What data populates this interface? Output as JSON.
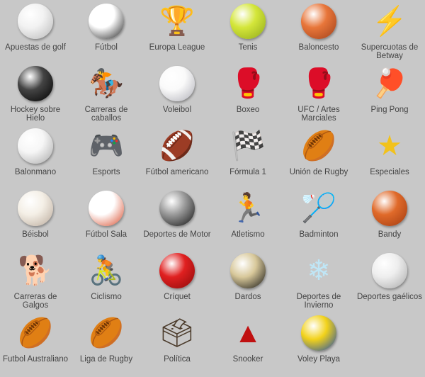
{
  "sports": [
    {
      "label": "Apuestas de golf",
      "icon": "golf-ball-icon",
      "shape": "ball",
      "color": "#f2f2f2",
      "shade": "#b8b8b8"
    },
    {
      "label": "Fútbol",
      "icon": "soccer-ball-icon",
      "shape": "ball",
      "color": "#ffffff",
      "shade": "#222222"
    },
    {
      "label": "Europa League",
      "icon": "trophy-icon",
      "shape": "glyph",
      "glyph": "🏆",
      "color": "#9a9a9a"
    },
    {
      "label": "Tenis",
      "icon": "tennis-ball-icon",
      "shape": "ball",
      "color": "#d4e63a",
      "shade": "#8fa81a"
    },
    {
      "label": "Baloncesto",
      "icon": "basketball-icon",
      "shape": "ball",
      "color": "#e8763a",
      "shade": "#a0401a"
    },
    {
      "label": "Supercuotas de\nBetway",
      "icon": "lightning-icon",
      "shape": "glyph",
      "glyph": "⚡",
      "color": "#3cb53c"
    },
    {
      "label": "Hockey sobre\nHielo",
      "icon": "hockey-puck-icon",
      "shape": "ball",
      "color": "#444444",
      "shade": "#000000"
    },
    {
      "label": "Carreras de\ncaballos",
      "icon": "horse-racing-icon",
      "shape": "glyph",
      "glyph": "🏇",
      "color": "#6b3a1f"
    },
    {
      "label": "Voleibol",
      "icon": "volleyball-icon",
      "shape": "ball",
      "color": "#fafafa",
      "shade": "#b0b0b8"
    },
    {
      "label": "Boxeo",
      "icon": "boxing-gloves-icon",
      "shape": "glyph",
      "glyph": "🥊",
      "color": "#a81c1c"
    },
    {
      "label": "UFC / Artes\nMarciales",
      "icon": "mma-gloves-icon",
      "shape": "glyph",
      "glyph": "🥊",
      "color": "#222222"
    },
    {
      "label": "Ping Pong",
      "icon": "ping-pong-icon",
      "shape": "glyph",
      "glyph": "🏓",
      "color": "#d42020"
    },
    {
      "label": "Balonmano",
      "icon": "handball-icon",
      "shape": "ball",
      "color": "#f6f6f6",
      "shade": "#a8a8a8"
    },
    {
      "label": "Esports",
      "icon": "gamepad-icon",
      "shape": "glyph",
      "glyph": "🎮",
      "color": "#333333"
    },
    {
      "label": "Fútbol americano",
      "icon": "american-football-icon",
      "shape": "glyph",
      "glyph": "🏈",
      "color": "#8b4513"
    },
    {
      "label": "Fórmula 1",
      "icon": "checkered-flag-icon",
      "shape": "glyph",
      "glyph": "🏁",
      "color": "#000000"
    },
    {
      "label": "Unión de Rugby",
      "icon": "rugby-ball-icon",
      "shape": "glyph",
      "glyph": "🏉",
      "color": "#4a8a4a"
    },
    {
      "label": "Especiales",
      "icon": "star-icon",
      "shape": "glyph",
      "glyph": "★",
      "color": "#f2c21b"
    },
    {
      "label": "Béisbol",
      "icon": "baseball-icon",
      "shape": "ball",
      "color": "#f4efe6",
      "shade": "#b9a99a"
    },
    {
      "label": "Fútbol Sala",
      "icon": "futsal-ball-icon",
      "shape": "ball",
      "color": "#ffffff",
      "shade": "#d84a2a"
    },
    {
      "label": "Deportes de Motor",
      "icon": "tyre-icon",
      "shape": "ball",
      "color": "#9a9a9a",
      "shade": "#111111"
    },
    {
      "label": "Atletismo",
      "icon": "runner-icon",
      "shape": "glyph",
      "glyph": "🏃",
      "color": "#5a3a1f"
    },
    {
      "label": "Badminton",
      "icon": "shuttlecock-icon",
      "shape": "glyph",
      "glyph": "🏸",
      "color": "#f0f0f0"
    },
    {
      "label": "Bandy",
      "icon": "bandy-ball-icon",
      "shape": "ball",
      "color": "#e06a2a",
      "shade": "#a03a10"
    },
    {
      "label": "Carreras de\nGalgos",
      "icon": "greyhound-icon",
      "shape": "glyph",
      "glyph": "🐕",
      "color": "#8a6a4a"
    },
    {
      "label": "Ciclismo",
      "icon": "bicycle-icon",
      "shape": "glyph",
      "glyph": "🚴",
      "color": "#222222"
    },
    {
      "label": "Críquet",
      "icon": "cricket-ball-icon",
      "shape": "ball",
      "color": "#e02020",
      "shade": "#8a0a0a"
    },
    {
      "label": "Dardos",
      "icon": "dartboard-icon",
      "shape": "ball",
      "color": "#d8c89a",
      "shade": "#111111"
    },
    {
      "label": "Deportes de\nInvierno",
      "icon": "snowflake-icon",
      "shape": "glyph",
      "glyph": "❄",
      "color": "#bfe6f6"
    },
    {
      "label": "Deportes gaélicos",
      "icon": "hurling-icon",
      "shape": "ball",
      "color": "#eeeeee",
      "shade": "#aaaaaa"
    },
    {
      "label": "Futbol Australiano",
      "icon": "australian-football-icon",
      "shape": "glyph",
      "glyph": "🏉",
      "color": "#c81818"
    },
    {
      "label": "Liga de Rugby",
      "icon": "rugby-league-ball-icon",
      "shape": "glyph",
      "glyph": "🏉",
      "color": "#f0e6dc"
    },
    {
      "label": "Política",
      "icon": "ballot-box-icon",
      "shape": "glyph",
      "glyph": "🗳",
      "color": "#4a3a2a"
    },
    {
      "label": "Snooker",
      "icon": "snooker-balls-icon",
      "shape": "glyph",
      "glyph": "▲",
      "color": "#c01010"
    },
    {
      "label": "Voley Playa",
      "icon": "beach-volleyball-icon",
      "shape": "ball",
      "color": "#f2d21a",
      "shade": "#1a4ab0"
    }
  ]
}
